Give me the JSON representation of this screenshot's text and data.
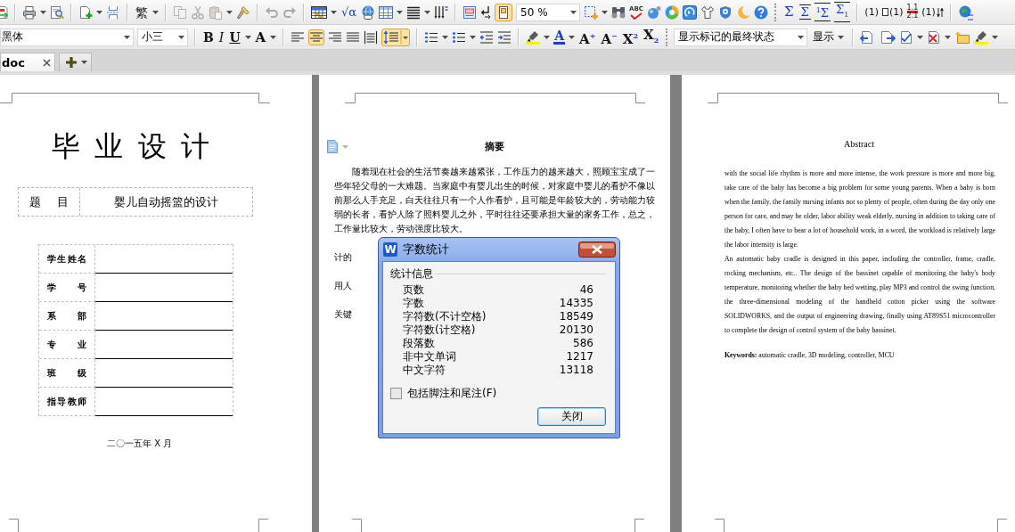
{
  "toolbar": {
    "convert_button": "繁",
    "formula_button": "√α",
    "frame_button": {
      "on": true
    },
    "zoom_field": {
      "value": "50 %"
    },
    "spell_check_button": "ABC",
    "sum_buttons": [
      "Σ",
      "Σ",
      "$^{1}$Σ",
      "Σ$_{1}$"
    ],
    "numbering_buttons": [
      {
        "lines": [
          "(1)"
        ]
      },
      {
        "lines": [
          "(1)"
        ]
      },
      {
        "lines": [
          "1.1",
          "2.1"
        ]
      },
      {
        "lines": [
          "(1)"
        ]
      }
    ]
  },
  "format_bar": {
    "font_field": {
      "value": "黑体"
    },
    "size_field": {
      "value": "小三"
    },
    "style_buttons": [
      {
        "label": "B",
        "on": false
      },
      {
        "label": "I",
        "on": false
      },
      {
        "label": "U",
        "on": false
      }
    ],
    "effects_button": "A",
    "align_buttons": [
      {
        "on": false
      },
      {
        "on": true
      },
      {
        "on": false
      },
      {
        "on": false
      },
      {
        "on": false
      }
    ],
    "line_spacing_button": {
      "on": true
    },
    "font_color_button": "A",
    "size_buttons": [
      "A$^{+}$",
      "A$^{−}$"
    ],
    "script_buttons": [
      "X$^{2}$",
      "X$_{2}$"
    ],
    "markup_field": {
      "value": "显示标记的最终状态"
    },
    "show_button": "显示"
  },
  "tabs": [
    {
      "label": "doc",
      "selected": true
    }
  ],
  "cover_page": {
    "title": "毕 业 设 计",
    "topic": {
      "label": "题 目",
      "value": "婴儿自动摇篮的设计"
    },
    "info_rows": [
      {
        "label": "学生姓名"
      },
      {
        "label": "学 号"
      },
      {
        "label": "系 部"
      },
      {
        "label": "专 业"
      },
      {
        "label": "班 级"
      },
      {
        "label": "指导教师"
      }
    ],
    "date": "二〇一五年 X 月"
  },
  "chinese_abstract_page": {
    "heading": "摘要",
    "paragraph": "随着现在社会的生活节奏越来越紧张，工作压力的越来越大，照顾宝宝成了一些年轻父母的一大难题。当家庭中有婴儿出生的时候，对家庭中婴儿的看护不像以前那么人手充足，白天往往只有一个人作看护，且可能是年龄较大的，劳动能力较弱的长者，看护人除了照料婴儿之外，平时往往还要承担大量的家务工作，总之，工作量比较大，劳动强度比较大。",
    "covered_lines": [
      "计的",
      "用人"
    ],
    "keywords_fragment": "关键"
  },
  "english_abstract_page": {
    "heading": "Abstract",
    "paragraphs": [
      "with the social life rhythm is more and more intense, the work pressure is more and more big, take care of the baby has become a big problem for some young parents. When a baby is born when the family, the family nursing infants not so plenty of people, often during the day only one person for care, and may be older, labor ability weak elderly, nursing in addition to taking care of the baby, I often have to bear a lot of household work, in a word, the workload is relatively large the labor intensity is large.",
      "An automatic baby cradle is designed in this paper, including the controller, frame, cradle, rocking mechanism, etc.. The design of the bassinet capable of monitoring the baby's body temperature, monitoring whether the baby bed wetting, play MP3 and control the swing function, the three-dimensional modeling of the handheld cotton picker using the software SOLIDWORKS, and the output of engineering drawing, finally using AT89S51 microcontroller to complete the design of control system of the baby bassinet."
    ],
    "keywords": "**Keywords:** automatic cradle, 3D modeling, controller, MCU"
  },
  "dialog": {
    "icon_letter": "W",
    "title": "字数统计",
    "group_label": "统计信息",
    "stats": [
      {
        "label": "页数",
        "value": "46"
      },
      {
        "label": "字数",
        "value": "14335"
      },
      {
        "label": "字符数(不计空格)",
        "value": "18549"
      },
      {
        "label": "字符数(计空格)",
        "value": "20130"
      },
      {
        "label": "段落数",
        "value": "586"
      },
      {
        "label": "非中文单词",
        "value": "1217"
      },
      {
        "label": "中文字符",
        "value": "13118"
      }
    ],
    "checkbox": {
      "label": "包括脚注和尾注(F)",
      "checked": false
    },
    "close_button": "关闭"
  }
}
